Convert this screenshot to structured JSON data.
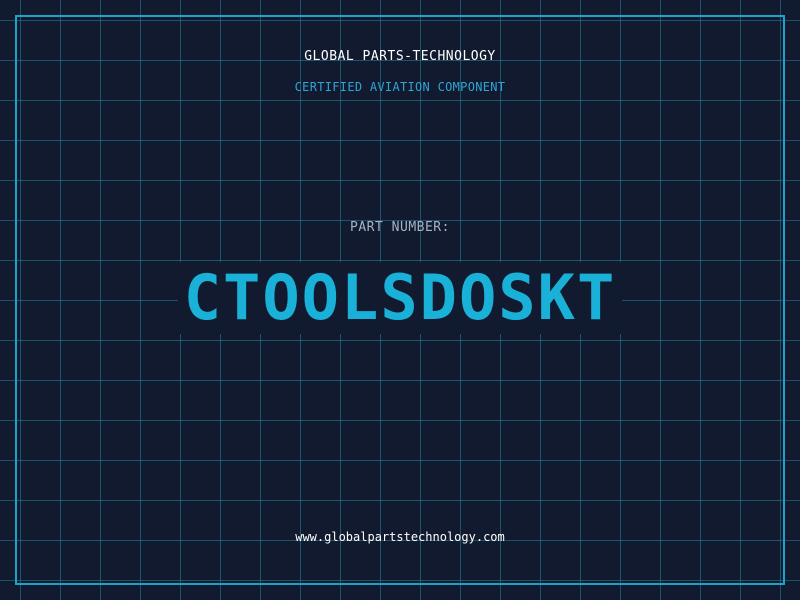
{
  "header": {
    "company": "GLOBAL PARTS-TECHNOLOGY",
    "tagline": "CERTIFIED AVIATION COMPONENT"
  },
  "part": {
    "label": "PART NUMBER:",
    "number": "CTOOLSDOSKT"
  },
  "footer": {
    "website": "www.globalpartstechnology.com"
  },
  "colors": {
    "background": "#111a2e",
    "grid": "#2684a0",
    "accent": "#19b1d8",
    "border": "#1ba3c9"
  }
}
